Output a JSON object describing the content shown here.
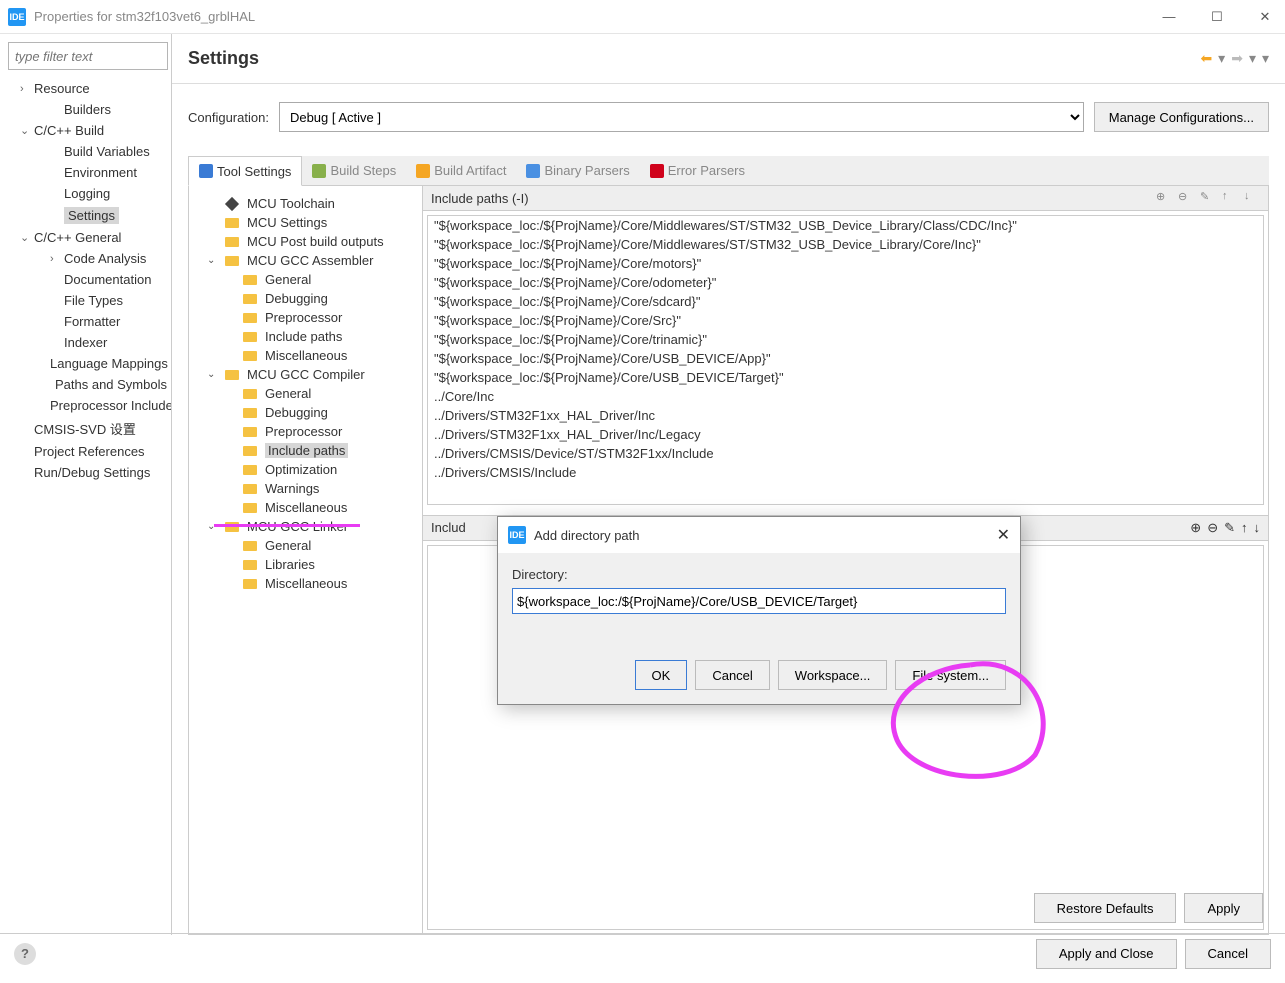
{
  "window": {
    "app_icon_text": "IDE",
    "title": "Properties for stm32f103vet6_grblHAL",
    "min": "—",
    "max": "☐",
    "close": "✕"
  },
  "filter_placeholder": "type filter text",
  "nav": [
    {
      "label": "Resource",
      "indent": "l1",
      "arrow": "›"
    },
    {
      "label": "Builders",
      "indent": "l2"
    },
    {
      "label": "C/C++ Build",
      "indent": "l1",
      "arrow": "⌄"
    },
    {
      "label": "Build Variables",
      "indent": "l2"
    },
    {
      "label": "Environment",
      "indent": "l2"
    },
    {
      "label": "Logging",
      "indent": "l2"
    },
    {
      "label": "Settings",
      "indent": "l2",
      "selected": true
    },
    {
      "label": "C/C++ General",
      "indent": "l1",
      "arrow": "⌄"
    },
    {
      "label": "Code Analysis",
      "indent": "l2",
      "arrow": "›"
    },
    {
      "label": "Documentation",
      "indent": "l2"
    },
    {
      "label": "File Types",
      "indent": "l2"
    },
    {
      "label": "Formatter",
      "indent": "l2"
    },
    {
      "label": "Indexer",
      "indent": "l2"
    },
    {
      "label": "Language Mappings",
      "indent": "l2"
    },
    {
      "label": "Paths and Symbols",
      "indent": "l2"
    },
    {
      "label": "Preprocessor Include Paths",
      "indent": "l2"
    },
    {
      "label": "CMSIS-SVD 设置",
      "indent": "l1"
    },
    {
      "label": "Project References",
      "indent": "l1"
    },
    {
      "label": "Run/Debug Settings",
      "indent": "l1"
    }
  ],
  "settings_title": "Settings",
  "configuration": {
    "label": "Configuration:",
    "value": "Debug  [ Active ]",
    "manage": "Manage Configurations..."
  },
  "tabs": [
    "Tool Settings",
    "Build Steps",
    "Build Artifact",
    "Binary Parsers",
    "Error Parsers"
  ],
  "tool_tree": [
    {
      "label": "MCU Toolchain",
      "d": "d1",
      "ico": "ico-diamond"
    },
    {
      "label": "MCU Settings",
      "d": "d1",
      "ico": "ico-folder"
    },
    {
      "label": "MCU Post build outputs",
      "d": "d1",
      "ico": "ico-folder"
    },
    {
      "label": "MCU GCC Assembler",
      "d": "d1",
      "arrow": "⌄",
      "ico": "ico-folder"
    },
    {
      "label": "General",
      "d": "d2",
      "ico": "ico-folder"
    },
    {
      "label": "Debugging",
      "d": "d2",
      "ico": "ico-folder"
    },
    {
      "label": "Preprocessor",
      "d": "d2",
      "ico": "ico-folder"
    },
    {
      "label": "Include paths",
      "d": "d2",
      "ico": "ico-folder"
    },
    {
      "label": "Miscellaneous",
      "d": "d2",
      "ico": "ico-folder"
    },
    {
      "label": "MCU GCC Compiler",
      "d": "d1",
      "arrow": "⌄",
      "ico": "ico-folder"
    },
    {
      "label": "General",
      "d": "d2",
      "ico": "ico-folder"
    },
    {
      "label": "Debugging",
      "d": "d2",
      "ico": "ico-folder"
    },
    {
      "label": "Preprocessor",
      "d": "d2",
      "ico": "ico-folder"
    },
    {
      "label": "Include paths",
      "d": "d2",
      "ico": "ico-folder",
      "sel": true
    },
    {
      "label": "Optimization",
      "d": "d2",
      "ico": "ico-folder"
    },
    {
      "label": "Warnings",
      "d": "d2",
      "ico": "ico-folder"
    },
    {
      "label": "Miscellaneous",
      "d": "d2",
      "ico": "ico-folder"
    },
    {
      "label": "MCU GCC Linker",
      "d": "d1",
      "arrow": "⌄",
      "ico": "ico-folder"
    },
    {
      "label": "General",
      "d": "d2",
      "ico": "ico-folder"
    },
    {
      "label": "Libraries",
      "d": "d2",
      "ico": "ico-folder"
    },
    {
      "label": "Miscellaneous",
      "d": "d2",
      "ico": "ico-folder"
    }
  ],
  "include_paths": {
    "header": "Include paths (-I)",
    "items": [
      "\"${workspace_loc:/${ProjName}/Core/Middlewares/ST/STM32_USB_Device_Library/Class/CDC/Inc}\"",
      "\"${workspace_loc:/${ProjName}/Core/Middlewares/ST/STM32_USB_Device_Library/Core/Inc}\"",
      "\"${workspace_loc:/${ProjName}/Core/motors}\"",
      "\"${workspace_loc:/${ProjName}/Core/odometer}\"",
      "\"${workspace_loc:/${ProjName}/Core/sdcard}\"",
      "\"${workspace_loc:/${ProjName}/Core/Src}\"",
      "\"${workspace_loc:/${ProjName}/Core/trinamic}\"",
      "\"${workspace_loc:/${ProjName}/Core/USB_DEVICE/App}\"",
      "\"${workspace_loc:/${ProjName}/Core/USB_DEVICE/Target}\"",
      "../Core/Inc",
      "../Drivers/STM32F1xx_HAL_Driver/Inc",
      "../Drivers/STM32F1xx_HAL_Driver/Inc/Legacy",
      "../Drivers/CMSIS/Device/ST/STM32F1xx/Include",
      "../Drivers/CMSIS/Include"
    ],
    "header2": "Includ"
  },
  "dialog": {
    "title": "Add directory path",
    "field_label": "Directory:",
    "value": "${workspace_loc:/${ProjName}/Core/USB_DEVICE/Target}",
    "ok": "OK",
    "cancel": "Cancel",
    "workspace": "Workspace...",
    "filesystem": "File system..."
  },
  "footer": {
    "restore": "Restore Defaults",
    "apply": "Apply",
    "apply_close": "Apply and Close",
    "cancel": "Cancel"
  }
}
